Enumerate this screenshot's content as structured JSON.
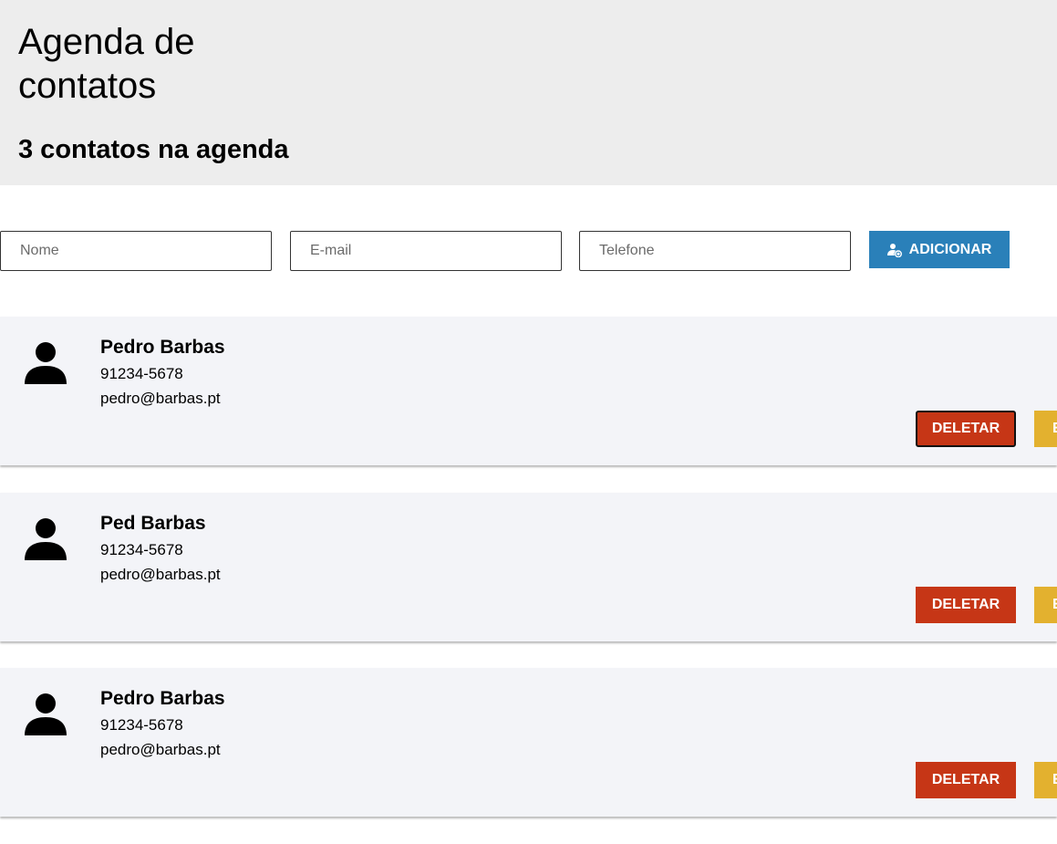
{
  "header": {
    "title": "Agenda de contatos",
    "count_text": "3 contatos na agenda"
  },
  "form": {
    "name_placeholder": "Nome",
    "email_placeholder": "E-mail",
    "phone_placeholder": "Telefone",
    "add_label": "ADICIONAR",
    "add_icon": "add-user-icon"
  },
  "contacts": [
    {
      "name": "Pedro Barbas",
      "phone": "91234-5678",
      "email": "pedro@barbas.pt",
      "delete_label": "DELETAR",
      "edit_label": "EDITAR"
    },
    {
      "name": "Ped Barbas",
      "phone": "91234-5678",
      "email": "pedro@barbas.pt",
      "delete_label": "DELETAR",
      "edit_label": "EDITAR"
    },
    {
      "name": "Pedro Barbas",
      "phone": "91234-5678",
      "email": "pedro@barbas.pt",
      "delete_label": "DELETAR",
      "edit_label": "EDITAR"
    }
  ],
  "colors": {
    "header_bg": "#ededed",
    "card_bg": "#f3f4f8",
    "add_button": "#2a80b9",
    "delete_button": "#c63616",
    "edit_button": "#e3b12f"
  },
  "icons": {
    "avatar": "person-icon"
  }
}
